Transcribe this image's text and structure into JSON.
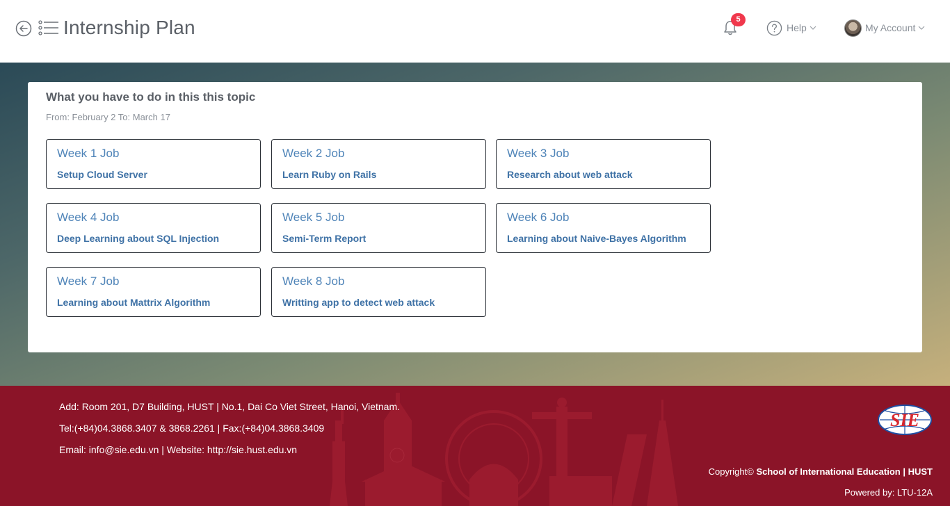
{
  "header": {
    "title": "Internship Plan",
    "notification_count": "5",
    "help_label": "Help",
    "account_label": "My Account"
  },
  "topic": {
    "heading": "What you have to do in this this topic",
    "date_range": "From: February 2 To: March 17"
  },
  "jobs": [
    {
      "week": "Week 1 Job",
      "task": "Setup Cloud Server"
    },
    {
      "week": "Week 2 Job",
      "task": "Learn Ruby on Rails"
    },
    {
      "week": "Week 3 Job",
      "task": "Research about web attack"
    },
    {
      "week": "Week 4 Job",
      "task": "Deep Learning about SQL Injection"
    },
    {
      "week": "Week 5 Job",
      "task": "Semi-Term Report"
    },
    {
      "week": "Week 6 Job",
      "task": "Learning about Naive-Bayes Algorithm"
    },
    {
      "week": "Week 7 Job",
      "task": "Learning about Mattrix Algorithm"
    },
    {
      "week": "Week 8 Job",
      "task": "Writting app to detect web attack"
    }
  ],
  "footer": {
    "address": "Add: Room 201, D7 Building, HUST | No.1, Dai Co Viet Street, Hanoi, Vietnam.",
    "phone": "Tel:(+84)04.3868.3407 & 3868.2261 | Fax:(+84)04.3868.3409",
    "email": "Email: info@sie.edu.vn | Website: http://sie.hust.edu.vn",
    "copyright_prefix": "Copyright©",
    "copyright_org": "School of International Education | HUST",
    "powered_by": "Powered by: LTU-12A",
    "logo_text": "SIE"
  },
  "colors": {
    "accent_link": "#3f72a6",
    "badge": "#f0384c",
    "footer_bg": "#8b1428"
  }
}
